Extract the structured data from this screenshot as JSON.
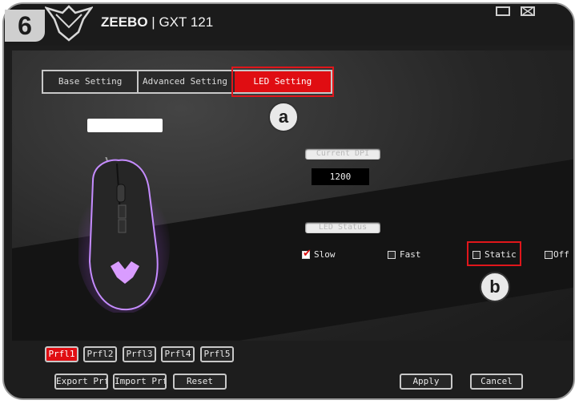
{
  "step_number": "6",
  "app": {
    "brand": "ZEEBO",
    "separator": "|",
    "model": "GXT 121",
    "logo_text": "GXT"
  },
  "tabs": [
    {
      "label": "Base Setting",
      "active": false
    },
    {
      "label": "Advanced Setting",
      "active": false
    },
    {
      "label": "LED Setting",
      "active": true
    }
  ],
  "callouts": {
    "a": "a",
    "b": "b"
  },
  "profile_name_value": "",
  "current_dpi": {
    "label": "Current DPI",
    "value": "1200"
  },
  "led_status": {
    "label": "LED Status",
    "options": [
      {
        "label": "Slow",
        "checked": true
      },
      {
        "label": "Fast",
        "checked": false
      },
      {
        "label": "Static",
        "checked": false
      },
      {
        "label": "Off",
        "checked": false
      }
    ]
  },
  "profiles": [
    "Prfl1",
    "Prfl2",
    "Prfl3",
    "Prfl4",
    "Prfl5"
  ],
  "active_profile": "Prfl1",
  "buttons": {
    "export": "Export Prfl",
    "import": "Import Prfl",
    "reset": "Reset",
    "apply": "Apply",
    "cancel": "Cancel"
  },
  "colors": {
    "accent": "#e00d12",
    "mouse_glow": "#b65cff"
  }
}
